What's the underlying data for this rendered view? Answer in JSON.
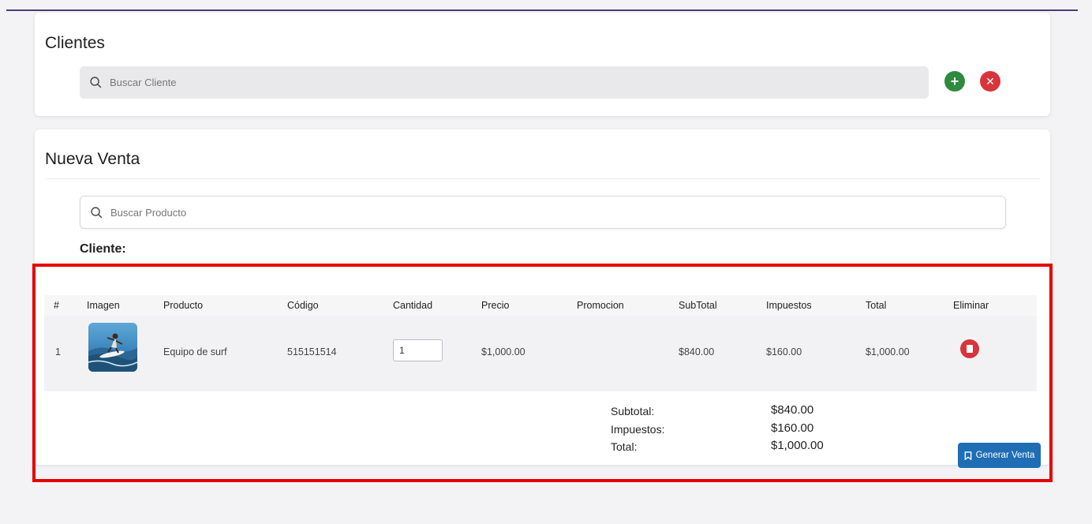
{
  "clientes": {
    "title": "Clientes",
    "search_placeholder": "Buscar Cliente",
    "add_button": "+",
    "clear_button": "✕"
  },
  "venta": {
    "title": "Nueva Venta",
    "search_placeholder": "Buscar Producto",
    "cliente_label": "Cliente:",
    "table": {
      "headers": [
        "#",
        "Imagen",
        "Producto",
        "Código",
        "Cantidad",
        "Precio",
        "Promocion",
        "SubTotal",
        "Impuestos",
        "Total",
        "Eliminar"
      ],
      "rows": [
        {
          "index": "1",
          "product": "Equipo de surf",
          "code": "515151514",
          "quantity": "1",
          "price": "$1,000.00",
          "promotion": "",
          "subtotal": "$840.00",
          "taxes": "$160.00",
          "total": "$1,000.00"
        }
      ]
    },
    "summary": {
      "subtotal_label": "Subtotal:",
      "subtotal_value": "$840.00",
      "taxes_label": "Impuestos:",
      "taxes_value": "$160.00",
      "total_label": "Total:",
      "total_value": "$1,000.00"
    },
    "generate_button": "Generar Venta"
  },
  "colors": {
    "add": "#2e8a3e",
    "danger": "#d8343c",
    "primary": "#1f6db5",
    "highlight": "#e60000"
  }
}
